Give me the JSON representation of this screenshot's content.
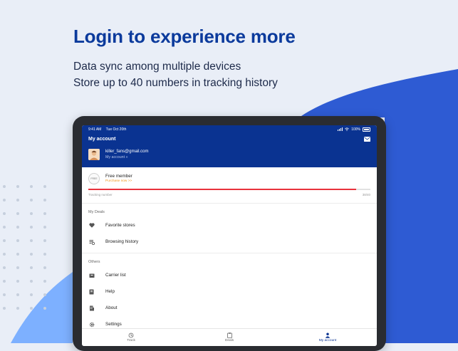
{
  "headline": "Login to experience more",
  "sublines": [
    "Data sync among multiple devices",
    "Store up to 40 numbers in tracking history"
  ],
  "colors": {
    "brand": "#0a3391",
    "progress": "#e8323c",
    "purchase": "#f39a1e"
  },
  "device": {
    "status": {
      "time": "9:41 AM",
      "date": "Tue Oct 20th",
      "battery": "100%"
    },
    "header": {
      "title": "My account",
      "email": "killer_fans@gmail.com",
      "account_link": "My account »",
      "mail_icon": "mail-icon"
    },
    "member": {
      "badge": "FREE",
      "title": "Free member",
      "purchase_link": "Purchase now >>",
      "tracking_label": "Tracking number",
      "tracking_count": "38/40",
      "progress_fraction": 0.95
    },
    "sections": {
      "my_deals": {
        "title": "My Deals",
        "items": [
          {
            "label": "Favorite stores",
            "icon": "heart-icon"
          },
          {
            "label": "Browsing history",
            "icon": "history-icon"
          }
        ]
      },
      "others": {
        "title": "Others",
        "items": [
          {
            "label": "Carrier list",
            "icon": "box-icon"
          },
          {
            "label": "Help",
            "icon": "book-icon"
          },
          {
            "label": "About",
            "icon": "building-icon"
          },
          {
            "label": "Settings",
            "icon": "gear-icon"
          }
        ]
      }
    },
    "tabs": [
      {
        "label": "Track",
        "icon": "track-icon"
      },
      {
        "label": "Deals",
        "icon": "deals-icon"
      },
      {
        "label": "My account",
        "icon": "person-icon",
        "active": true
      }
    ]
  }
}
